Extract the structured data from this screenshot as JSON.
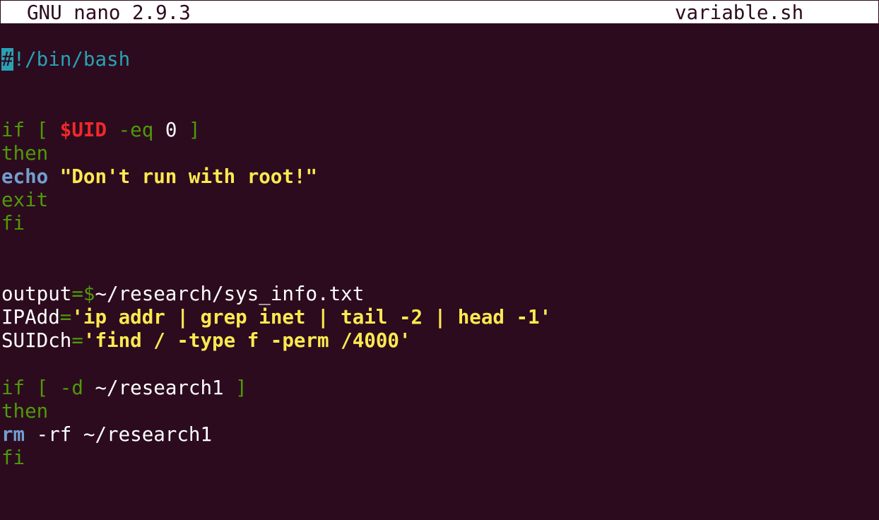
{
  "titlebar": {
    "app": "GNU nano 2.9.3",
    "filename": "variable.sh"
  },
  "code": {
    "l1_cursor": "#",
    "l1_rest": "!/bin/bash",
    "l4_if": "if [ ",
    "l4_var": "$UID",
    "l4_op": " -eq ",
    "l4_num": "0",
    "l4_close": " ]",
    "l5": "then",
    "l6_cmd": "echo",
    "l6_str": " \"Don't run with root!\"",
    "l7": "exit",
    "l8": "fi",
    "l11_name": "output",
    "l11_eq": "=$",
    "l11_val": "~/research/sys_info.txt",
    "l12_name": "IPAdd",
    "l12_eq": "=",
    "l12_str": "'ip addr | grep inet | tail -2 | head -1'",
    "l13_name": "SUIDch",
    "l13_eq": "=",
    "l13_str": "'find / -type f -perm /4000'",
    "l15_if": "if [ ",
    "l15_op": "-d",
    "l15_path": " ~/research1 ",
    "l15_close": "]",
    "l16": "then",
    "l17_cmd": "rm",
    "l17_rest": " -rf ~/research1",
    "l18": "fi"
  },
  "colors": {
    "background": "#2c0b1f",
    "keyword": "#4e9a06",
    "variable": "#ef2929",
    "command": "#729fcf",
    "string": "#fce94f",
    "shebang": "#2aa1b3"
  }
}
